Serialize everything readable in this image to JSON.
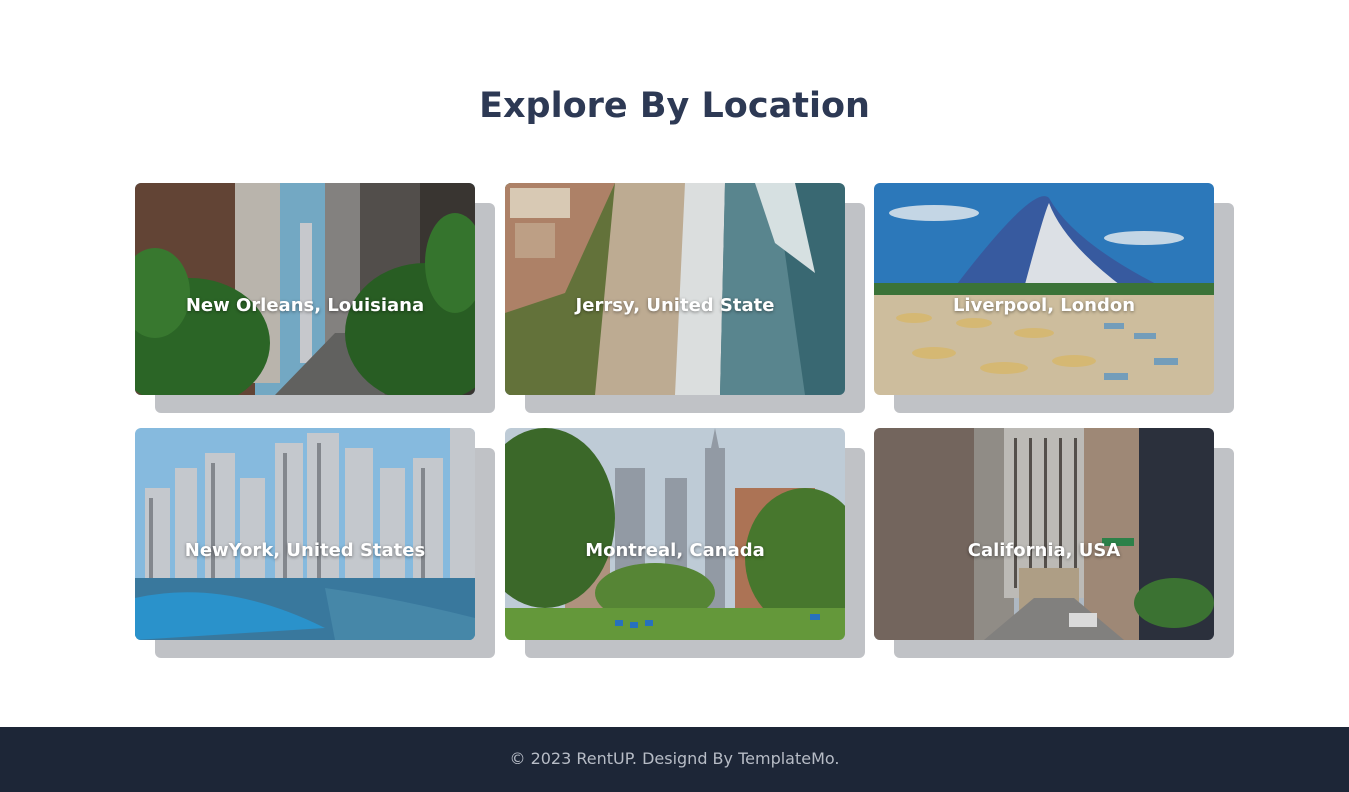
{
  "section": {
    "title": "Explore By Location"
  },
  "locations": [
    {
      "name": "New Orleans, Louisiana",
      "scene": "city-street"
    },
    {
      "name": "Jerrsy, United State",
      "scene": "coast-beach"
    },
    {
      "name": "Liverpool, London",
      "scene": "beach-resort"
    },
    {
      "name": "NewYork, United States",
      "scene": "marina-skyline"
    },
    {
      "name": "Montreal, Canada",
      "scene": "park-skyline"
    },
    {
      "name": "California, USA",
      "scene": "avenue-buildings"
    }
  ],
  "footer": {
    "copyright": "© 2023 RentUP. Designd By TemplateMo."
  },
  "colors": {
    "title": "#2d3954",
    "footer_bg": "#1d2637",
    "footer_text": "#b7bcc6",
    "card_shadow": "#8c9098"
  }
}
